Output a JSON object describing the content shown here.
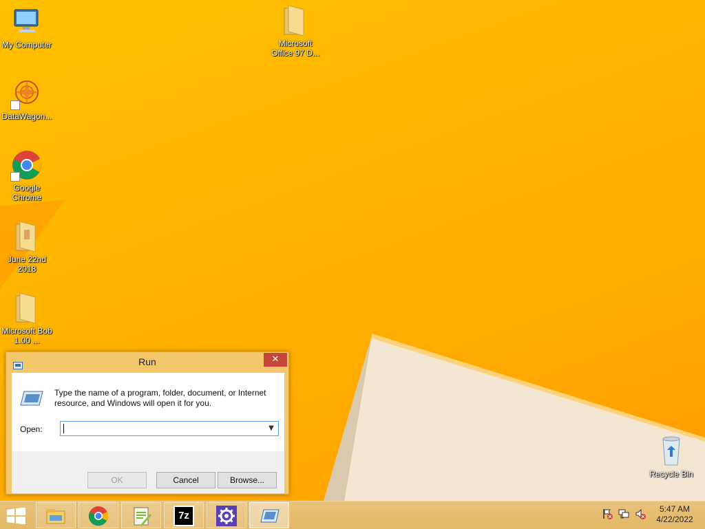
{
  "desktop": {
    "icons": [
      {
        "label": "My Computer",
        "icon": "computer-icon"
      },
      {
        "label": "DataWagon...",
        "icon": "datawagon-icon"
      },
      {
        "label": "Google Chrome",
        "icon": "chrome-icon"
      },
      {
        "label": "June 22nd 2018",
        "icon": "folder-icon"
      },
      {
        "label": "Microsoft Bob 1.00 ...",
        "icon": "folder-icon"
      },
      {
        "label": "Microsoft Office 97 D...",
        "icon": "folder-icon"
      },
      {
        "label": "Recycle Bin",
        "icon": "recycle-bin-icon"
      }
    ]
  },
  "run_dialog": {
    "title": "Run",
    "description": "Type the name of a program, folder, document, or Internet resource, and Windows will open it for you.",
    "open_label": "Open:",
    "input_value": "",
    "ok_label": "OK",
    "cancel_label": "Cancel",
    "browse_label": "Browse...",
    "close_glyph": "✕"
  },
  "taskbar": {
    "items": [
      {
        "icon": "file-explorer-icon"
      },
      {
        "icon": "chrome-icon"
      },
      {
        "icon": "notepad-plus-plus-icon"
      },
      {
        "icon": "7zip-icon",
        "text": "7z"
      },
      {
        "icon": "settings-gear-icon"
      },
      {
        "icon": "run-icon"
      }
    ],
    "clock": {
      "time": "5:47 AM",
      "date": "4/22/2022"
    }
  },
  "colors": {
    "wallpaper": "#ffb400",
    "dialog_frame": "#f4c86a",
    "close_button": "#c7463c",
    "input_border": "#569de5"
  }
}
